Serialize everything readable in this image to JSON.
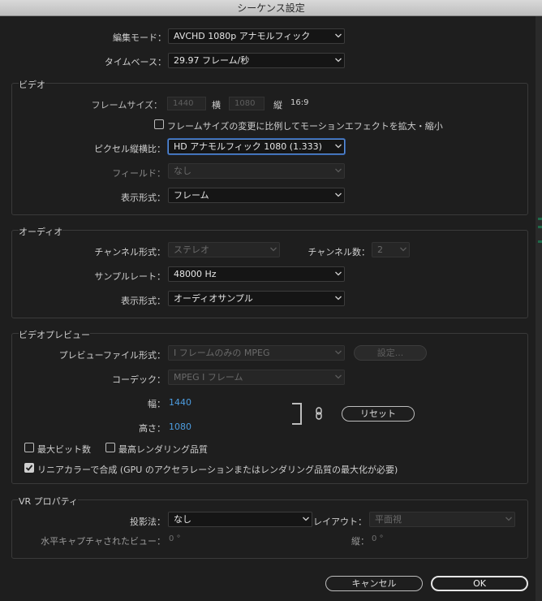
{
  "window": {
    "title": "シーケンス設定"
  },
  "top": {
    "edit_mode": {
      "label": "編集モード：",
      "value": "AVCHD 1080p アナモルフィック"
    },
    "timebase": {
      "label": "タイムベース：",
      "value": "29.97 フレーム/秒"
    }
  },
  "video": {
    "title": "ビデオ",
    "frame_size": {
      "label": "フレームサイズ：",
      "width": "1440",
      "h_label": "横",
      "height": "1080",
      "v_label": "縦",
      "aspect": "16:9"
    },
    "scale_motion": {
      "label": "フレームサイズの変更に比例してモーションエフェクトを拡大・縮小",
      "checked": false
    },
    "pixel_aspect": {
      "label": "ピクセル縦横比：",
      "value": "HD アナモルフィック 1080 (1.333)"
    },
    "fields": {
      "label": "フィールド：",
      "value": "なし"
    },
    "display_format": {
      "label": "表示形式：",
      "value": "フレーム"
    }
  },
  "audio": {
    "title": "オーディオ",
    "channel_format": {
      "label": "チャンネル形式：",
      "value": "ステレオ"
    },
    "channel_count": {
      "label": "チャンネル数：",
      "value": "2"
    },
    "sample_rate": {
      "label": "サンプルレート：",
      "value": "48000 Hz"
    },
    "display_format": {
      "label": "表示形式：",
      "value": "オーディオサンプル"
    }
  },
  "preview": {
    "title": "ビデオプレビュー",
    "file_format": {
      "label": "プレビューファイル形式：",
      "value": "I フレームのみの MPEG"
    },
    "settings_button": "設定...",
    "codec": {
      "label": "コーデック：",
      "value": "MPEG I フレーム"
    },
    "width": {
      "label": "幅：",
      "value": "1440"
    },
    "height": {
      "label": "高さ：",
      "value": "1080"
    },
    "reset_button": "リセット",
    "max_bit_depth": {
      "label": "最大ビット数",
      "checked": false
    },
    "max_render_quality": {
      "label": "最高レンダリング品質",
      "checked": false
    },
    "linear_color": {
      "label": "リニアカラーで合成 (GPU のアクセラレーションまたはレンダリング品質の最大化が必要)",
      "checked": true
    }
  },
  "vr": {
    "title": "VR プロパティ",
    "projection": {
      "label": "投影法：",
      "value": "なし"
    },
    "layout": {
      "label": "レイアウト：",
      "value": "平面視"
    },
    "h_captured": {
      "label": "水平キャプチャされたビュー：",
      "value": "0 °"
    },
    "vertical": {
      "label": "縦：",
      "value": "0 °"
    }
  },
  "buttons": {
    "cancel": "キャンセル",
    "ok": "OK"
  },
  "colors": {
    "accent_blue": "#4d9de0",
    "focus_ring": "#5e8fd6",
    "background": "#1e1e1e"
  }
}
